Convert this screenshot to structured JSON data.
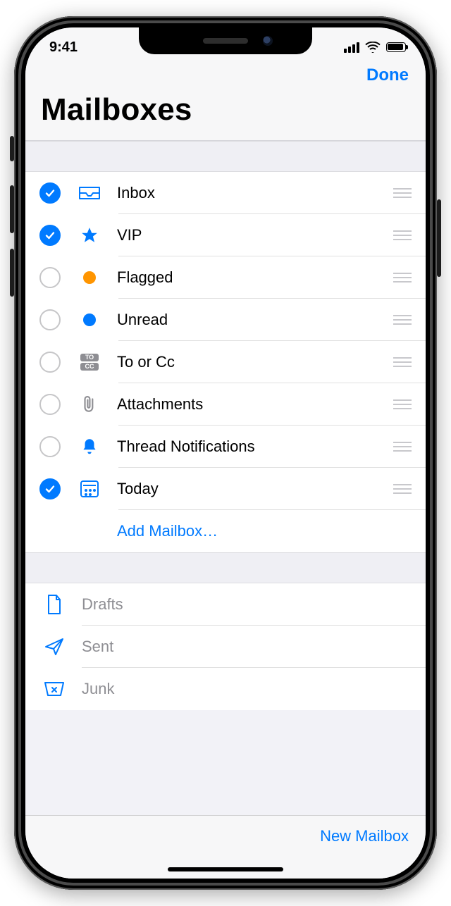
{
  "status": {
    "time": "9:41"
  },
  "header": {
    "done_label": "Done",
    "title": "Mailboxes"
  },
  "mailboxes": [
    {
      "label": "Inbox",
      "checked": true,
      "icon": "inbox"
    },
    {
      "label": "VIP",
      "checked": true,
      "icon": "star"
    },
    {
      "label": "Flagged",
      "checked": false,
      "icon": "flagdot"
    },
    {
      "label": "Unread",
      "checked": false,
      "icon": "unread"
    },
    {
      "label": "To or Cc",
      "checked": false,
      "icon": "tocc"
    },
    {
      "label": "Attachments",
      "checked": false,
      "icon": "clip"
    },
    {
      "label": "Thread Notifications",
      "checked": false,
      "icon": "bell"
    },
    {
      "label": "Today",
      "checked": true,
      "icon": "today"
    }
  ],
  "add_mailbox_label": "Add Mailbox…",
  "folders": [
    {
      "label": "Drafts",
      "icon": "draft"
    },
    {
      "label": "Sent",
      "icon": "sent"
    },
    {
      "label": "Junk",
      "icon": "junk"
    }
  ],
  "toolbar": {
    "new_mailbox_label": "New Mailbox"
  }
}
